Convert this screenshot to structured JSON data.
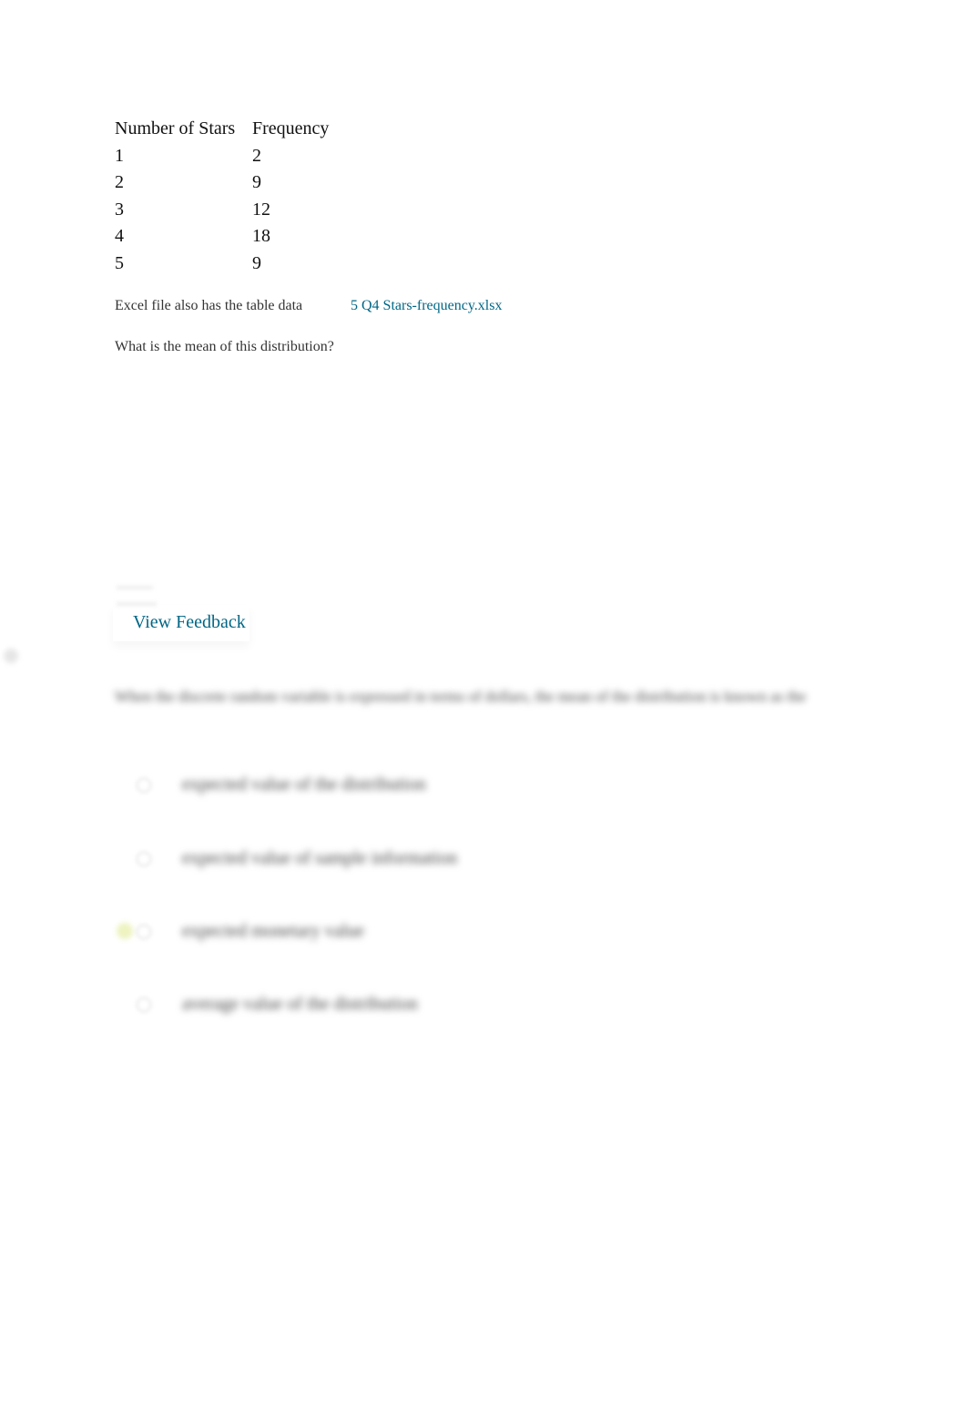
{
  "table": {
    "headers": [
      "Number of Stars",
      "Frequency"
    ],
    "rows": [
      [
        "1",
        "2"
      ],
      [
        "2",
        "9"
      ],
      [
        "3",
        "12"
      ],
      [
        "4",
        "18"
      ],
      [
        "5",
        "9"
      ]
    ]
  },
  "note": "Excel file also has the table data",
  "file_link": "5 Q4 Stars-frequency.xlsx",
  "question": "What is the mean of this distribution?",
  "view_feedback": "View Feedback",
  "next_question": "When the discrete random variable is expressed in terms of dollars, the mean of the distribution is known as the",
  "options": [
    "expected value of the distribution",
    "expected value of sample information",
    "expected monetary value",
    "average value of the distribution"
  ],
  "colors": {
    "link": "#006685",
    "selected": "#eef3c0"
  }
}
